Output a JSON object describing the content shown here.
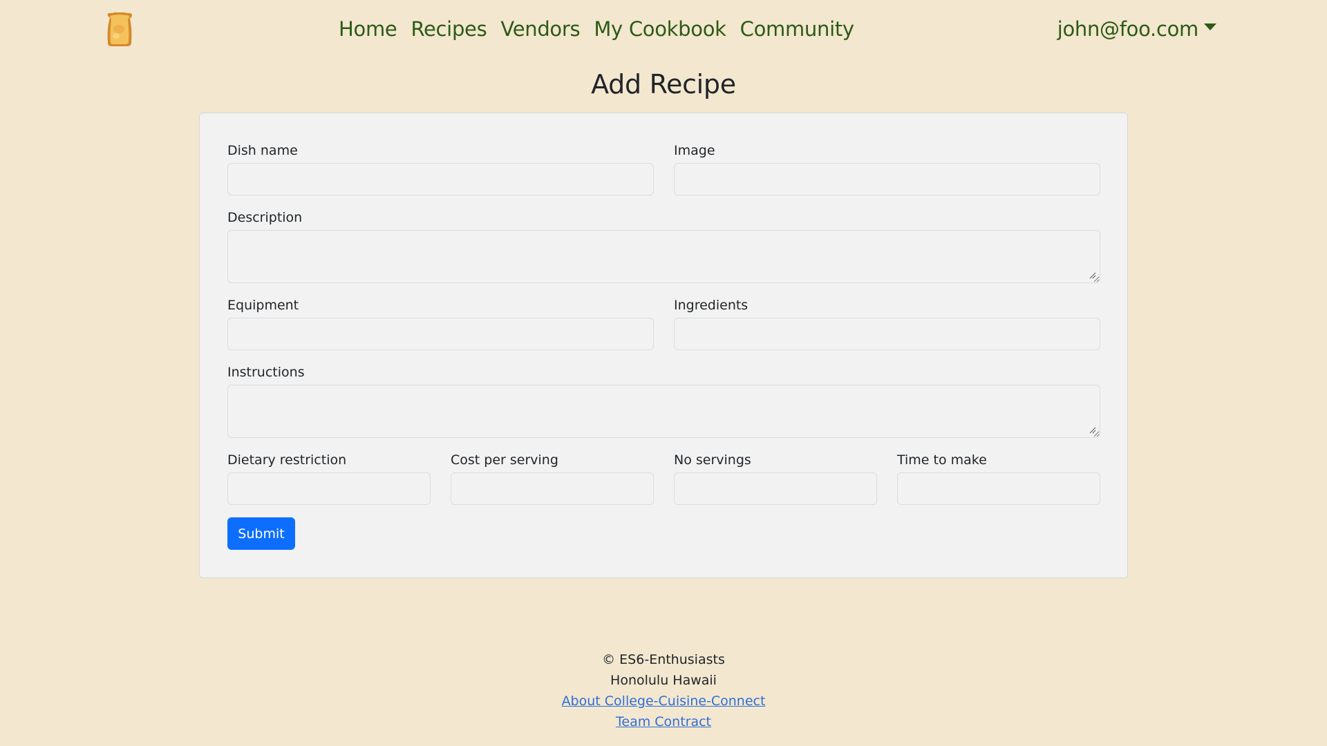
{
  "navbar": {
    "logo_icon": "toast-logo-icon",
    "links": [
      "Home",
      "Recipes",
      "Vendors",
      "My Cookbook",
      "Community"
    ],
    "user_email": "john@foo.com",
    "link_color": "#2d5a17"
  },
  "page": {
    "title": "Add Recipe",
    "background": "#f3e7cf"
  },
  "form": {
    "dish_name": {
      "label": "Dish name",
      "value": ""
    },
    "image": {
      "label": "Image",
      "value": ""
    },
    "description": {
      "label": "Description",
      "value": ""
    },
    "equipment": {
      "label": "Equipment",
      "value": ""
    },
    "ingredients": {
      "label": "Ingredients",
      "value": ""
    },
    "instructions": {
      "label": "Instructions",
      "value": ""
    },
    "dietary_restriction": {
      "label": "Dietary restriction",
      "value": ""
    },
    "cost_per_serving": {
      "label": "Cost per serving",
      "value": ""
    },
    "no_servings": {
      "label": "No servings",
      "value": ""
    },
    "time_to_make": {
      "label": "Time to make",
      "value": ""
    },
    "submit_label": "Submit",
    "submit_color": "#0d6efd"
  },
  "footer": {
    "copyright": "© ES6-Enthusiasts",
    "location": "Honolulu Hawaii",
    "about_link": "About College-Cuisine-Connect",
    "contract_link": "Team Contract"
  }
}
